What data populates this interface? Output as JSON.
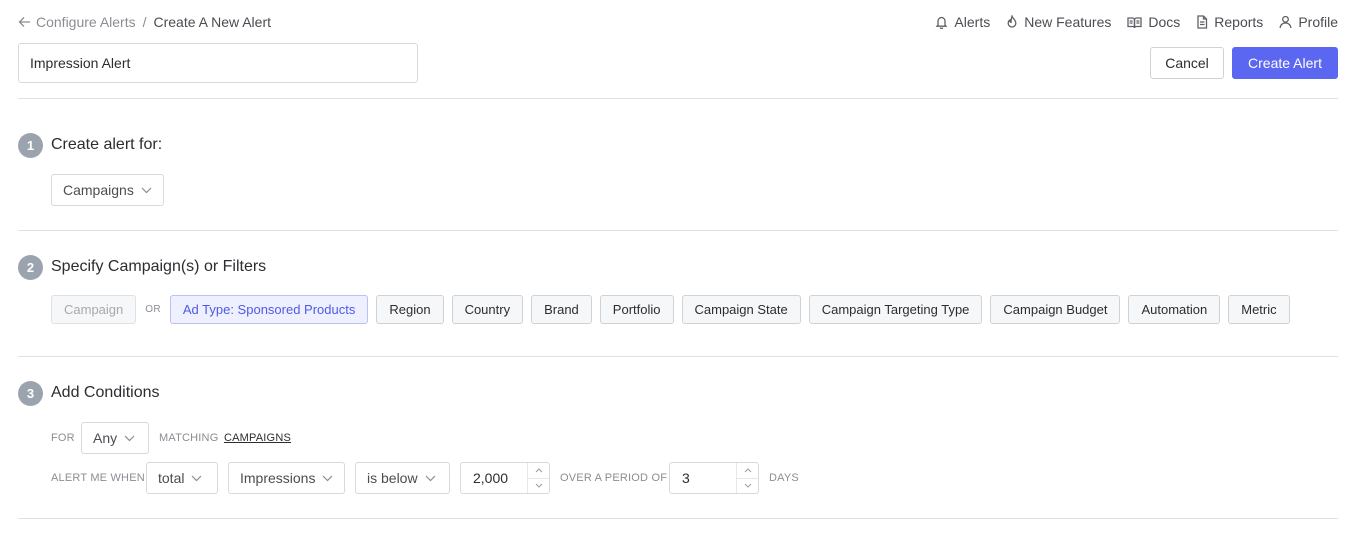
{
  "breadcrumb": {
    "parent": "Configure Alerts",
    "separator": "/",
    "current": "Create A New Alert"
  },
  "topnav": {
    "alerts": "Alerts",
    "new_features": "New Features",
    "docs": "Docs",
    "reports": "Reports",
    "profile": "Profile"
  },
  "alert_name": {
    "value": "Impression Alert"
  },
  "actions": {
    "cancel": "Cancel",
    "create": "Create Alert"
  },
  "step1": {
    "number": "1",
    "title": "Create alert for:",
    "selected": "Campaigns"
  },
  "step2": {
    "number": "2",
    "title": "Specify Campaign(s) or Filters",
    "campaign_placeholder": "Campaign",
    "or_label": "OR",
    "active_filter": "Ad Type: Sponsored Products",
    "filters": [
      "Region",
      "Country",
      "Brand",
      "Portfolio",
      "Campaign State",
      "Campaign Targeting Type",
      "Campaign Budget",
      "Automation",
      "Metric"
    ]
  },
  "step3": {
    "number": "3",
    "title": "Add Conditions",
    "for_label": "FOR",
    "for_value": "Any",
    "matching_label": "MATCHING",
    "matching_value": "CAMPAIGNS",
    "alert_when_label": "ALERT ME WHEN",
    "aggregate": "total",
    "metric": "Impressions",
    "operator": "is below",
    "threshold": "2,000",
    "period_label": "OVER A PERIOD OF",
    "period_value": "3",
    "period_unit": "DAYS"
  },
  "colors": {
    "accent": "#5b67f0",
    "active_chip_bg": "#eef0ff",
    "badge": "#9ba4ae"
  }
}
